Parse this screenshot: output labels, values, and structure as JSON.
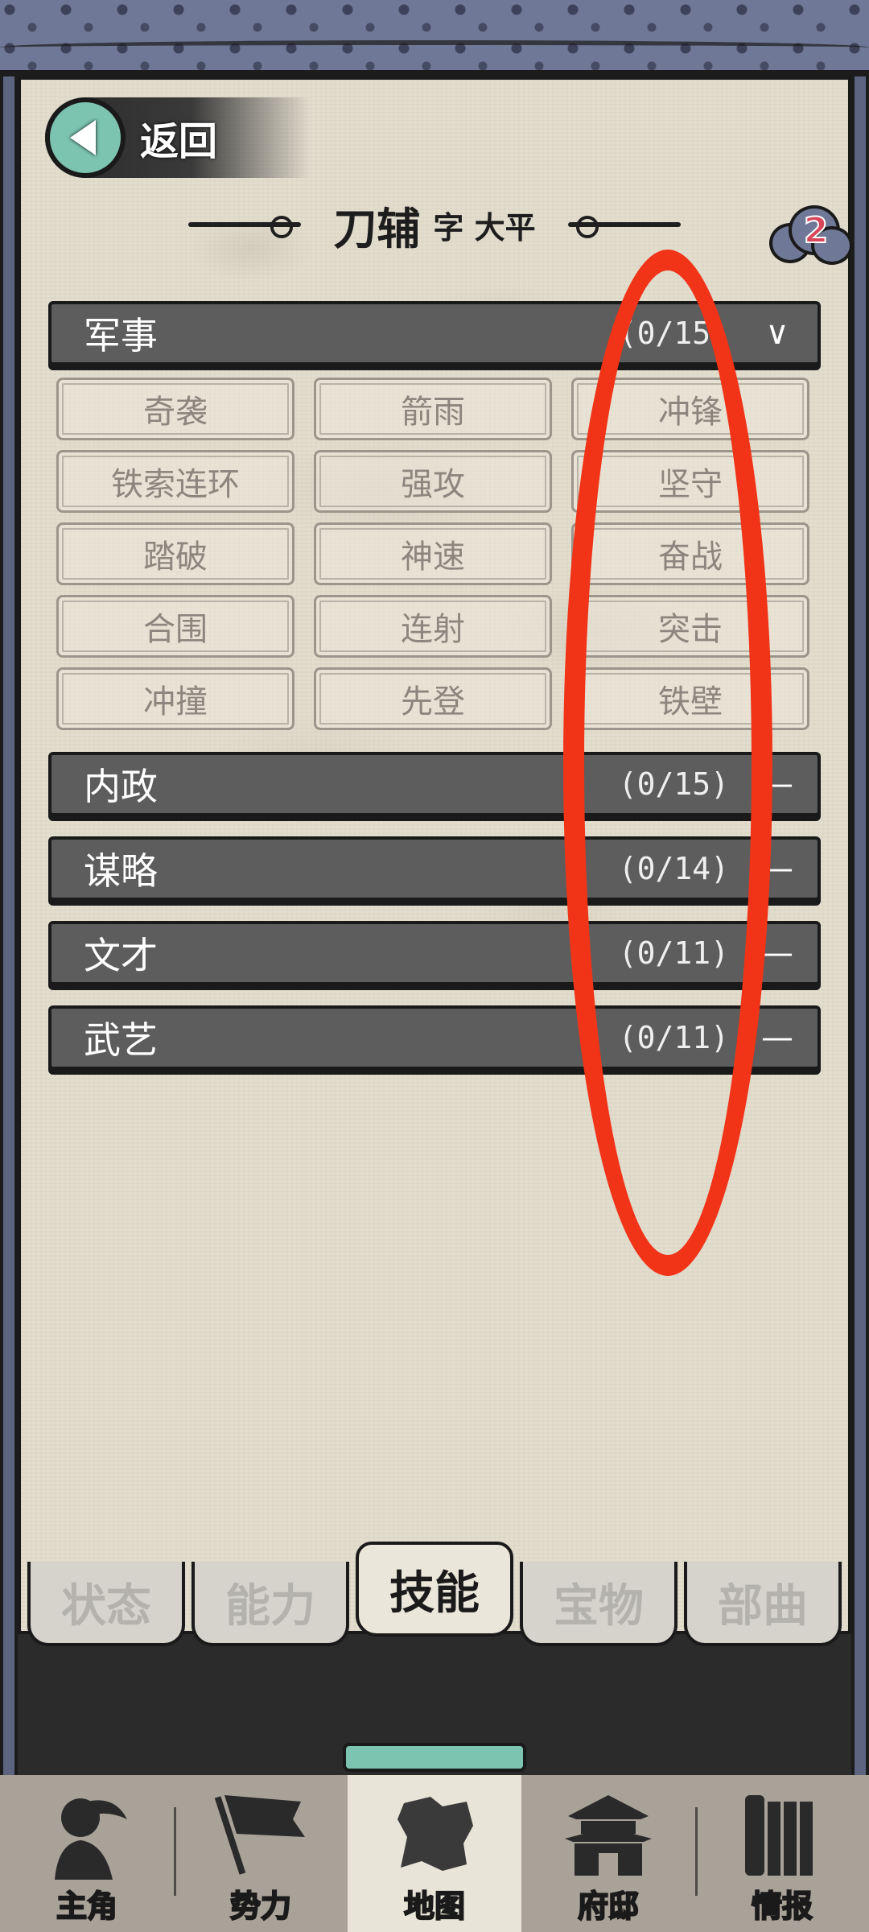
{
  "header": {
    "back_label": "返回",
    "name": "刀辅",
    "style_name": "字 大平",
    "notification_count": "2"
  },
  "categories": [
    {
      "name": "军事",
      "count": "(0/15)",
      "expanded": true,
      "toggle": "∨"
    },
    {
      "name": "内政",
      "count": "(0/15)",
      "expanded": false,
      "toggle": "—"
    },
    {
      "name": "谋略",
      "count": "(0/14)",
      "expanded": false,
      "toggle": "—"
    },
    {
      "name": "文才",
      "count": "(0/11)",
      "expanded": false,
      "toggle": "—"
    },
    {
      "name": "武艺",
      "count": "(0/11)",
      "expanded": false,
      "toggle": "—"
    }
  ],
  "military_skills": [
    "奇袭",
    "箭雨",
    "冲锋",
    "铁索连环",
    "强攻",
    "坚守",
    "踏破",
    "神速",
    "奋战",
    "合围",
    "连射",
    "突击",
    "冲撞",
    "先登",
    "铁壁"
  ],
  "tabs": [
    {
      "label": "状态",
      "active": false
    },
    {
      "label": "能力",
      "active": false
    },
    {
      "label": "技能",
      "active": true
    },
    {
      "label": "宝物",
      "active": false
    },
    {
      "label": "部曲",
      "active": false
    }
  ],
  "bottom_nav": [
    {
      "label": "主角",
      "icon": "warrior-icon",
      "active": false
    },
    {
      "label": "势力",
      "icon": "flag-icon",
      "active": false
    },
    {
      "label": "地图",
      "icon": "map-icon",
      "active": true
    },
    {
      "label": "府邸",
      "icon": "mansion-icon",
      "active": false
    },
    {
      "label": "情报",
      "icon": "scroll-icon",
      "active": false
    }
  ],
  "colors": {
    "parchment": "#e3ddce",
    "category_bar": "#5d5d5d",
    "accent_teal": "#7cc3b0",
    "frame_blue": "#6f7896",
    "annotation_red": "#f13418"
  }
}
